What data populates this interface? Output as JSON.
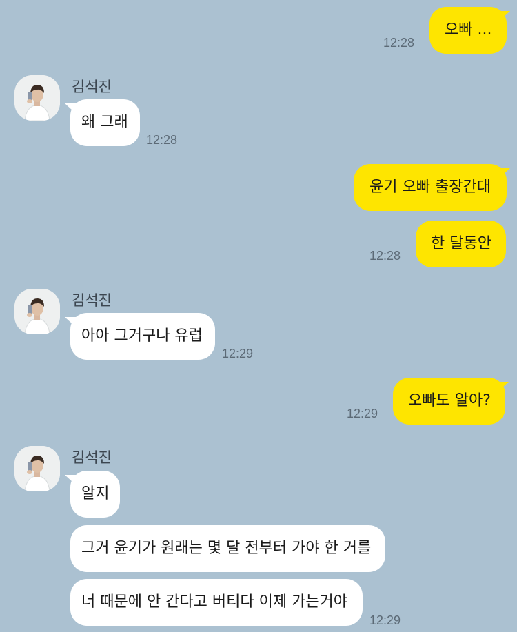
{
  "contact": {
    "name": "김석진"
  },
  "messages": [
    {
      "from": "me",
      "text": "오빠 ...",
      "time": "12:28"
    },
    {
      "from": "them",
      "text": "왜 그래",
      "time": "12:28"
    },
    {
      "from": "me",
      "text": "윤기 오빠 출장간대"
    },
    {
      "from": "me",
      "text": "한 달동안",
      "time": "12:28"
    },
    {
      "from": "them",
      "text": "아아 그거구나 유럽",
      "time": "12:29"
    },
    {
      "from": "me",
      "text": "오빠도 알아?",
      "time": "12:29"
    },
    {
      "from": "them",
      "text": "알지"
    },
    {
      "from": "them",
      "text": "그거 윤기가 원래는 몇 달 전부터 가야 한 거를"
    },
    {
      "from": "them",
      "text": "너 때문에 안 간다고 버티다 이제 가는거야",
      "time": "12:29"
    }
  ],
  "colors": {
    "background": "#abc1d1",
    "my_bubble": "#fee500",
    "their_bubble": "#ffffff"
  },
  "icons": {
    "avatar": "profile-photo"
  }
}
